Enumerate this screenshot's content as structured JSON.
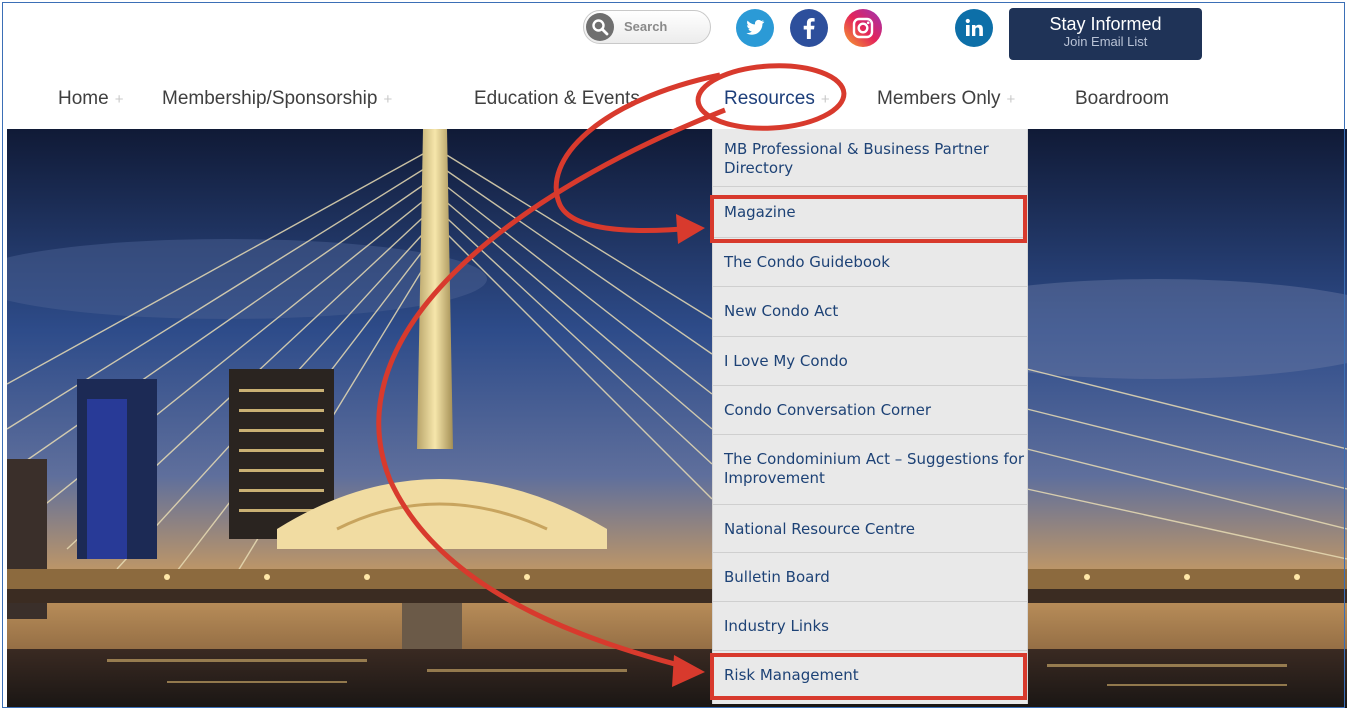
{
  "search": {
    "placeholder": "Search"
  },
  "social": [
    {
      "name": "twitter-icon",
      "color": "#2b9ad6"
    },
    {
      "name": "facebook-icon",
      "color": "#2d4f9c"
    },
    {
      "name": "instagram-icon",
      "color": "#d6286f"
    },
    {
      "name": "linkedin-icon",
      "color": "#0d6fa8"
    }
  ],
  "stay_informed": {
    "title": "Stay Informed",
    "subtitle": "Join Email List"
  },
  "nav": {
    "items": [
      {
        "label": "Home"
      },
      {
        "label": "Membership/Sponsorship"
      },
      {
        "label": "Education & Events"
      },
      {
        "label": "Resources"
      },
      {
        "label": "Members Only"
      },
      {
        "label": "Boardroom"
      }
    ],
    "plus": "+"
  },
  "dropdown": {
    "items": [
      {
        "label": "MB Professional & Business Partner Directory"
      },
      {
        "label": "Magazine"
      },
      {
        "label": "The Condo Guidebook"
      },
      {
        "label": "New Condo Act"
      },
      {
        "label": "I Love My Condo"
      },
      {
        "label": "Condo Conversation Corner"
      },
      {
        "label": "The Condominium Act – Suggestions for Improvement"
      },
      {
        "label": "National Resource Centre"
      },
      {
        "label": "Bulletin Board"
      },
      {
        "label": "Industry Links"
      },
      {
        "label": "Risk Management"
      }
    ]
  },
  "colors": {
    "accent": "#d83a2d",
    "link": "#1d4276",
    "button_bg": "#1f3357"
  }
}
